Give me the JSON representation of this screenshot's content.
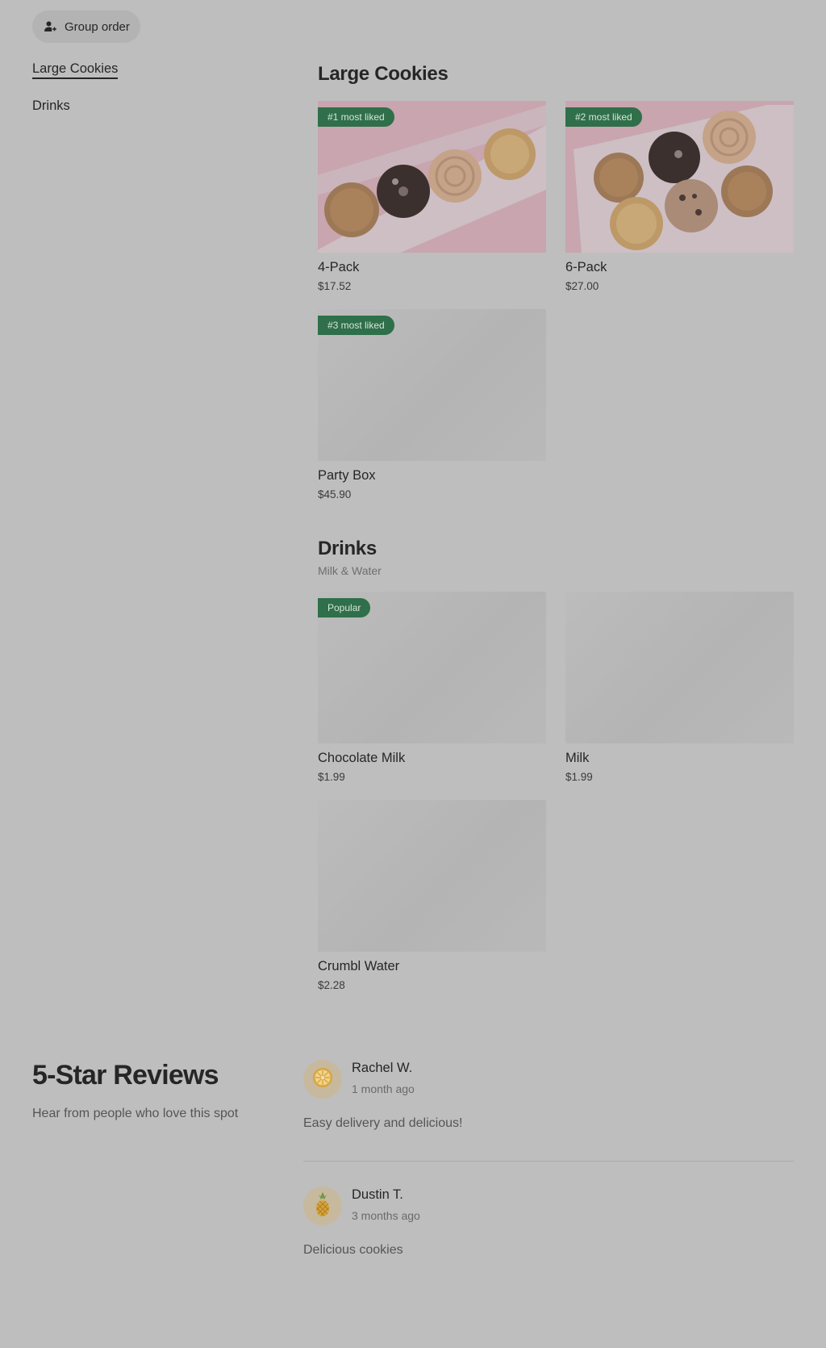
{
  "toolbar": {
    "group_order_label": "Group order",
    "group_order_icon": "user-plus-icon"
  },
  "nav": {
    "items": [
      {
        "label": "Large Cookies",
        "active": true
      },
      {
        "label": "Drinks",
        "active": false
      }
    ]
  },
  "sections": {
    "large_cookies": {
      "title": "Large Cookies",
      "items": [
        {
          "name": "4-Pack",
          "price": "$17.52",
          "badge": "#1 most liked"
        },
        {
          "name": "6-Pack",
          "price": "$27.00",
          "badge": "#2 most liked"
        },
        {
          "name": "Party Box",
          "price": "$45.90",
          "badge": "#3 most liked"
        }
      ]
    },
    "drinks": {
      "title": "Drinks",
      "subtitle": "Milk & Water",
      "items": [
        {
          "name": "Chocolate Milk",
          "price": "$1.99",
          "badge": "Popular"
        },
        {
          "name": "Milk",
          "price": "$1.99"
        },
        {
          "name": "Crumbl Water",
          "price": "$2.28"
        }
      ]
    }
  },
  "reviews": {
    "title": "5-Star Reviews",
    "subtitle": "Hear from people who love this spot",
    "items": [
      {
        "name": "Rachel W.",
        "time": "1 month ago",
        "text": "Easy delivery and delicious!",
        "avatar_icon": "lemon-slice-icon"
      },
      {
        "name": "Dustin T.",
        "time": "3 months ago",
        "text": "Delicious cookies",
        "avatar_icon": "pineapple-icon"
      }
    ]
  },
  "colors": {
    "background": "#bebebe",
    "badge": "#2f6f49",
    "text": "#262626"
  }
}
